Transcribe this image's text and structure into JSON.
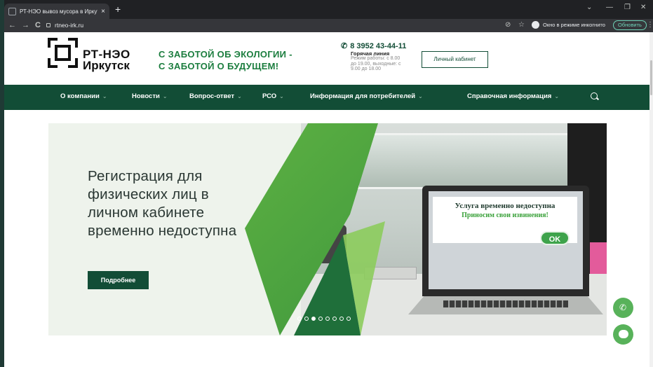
{
  "browser": {
    "tab_title": "РТ-НЭО вывоз мусора в Иркутс",
    "tab_close": "×",
    "new_tab": "+",
    "url": "rtneo-irk.ru",
    "incognito_label": "Окно в режиме инкогнито",
    "update_label": "Обновить",
    "nav": {
      "back": "←",
      "forward": "→",
      "reload": "C"
    },
    "window_controls": {
      "chevron": "⌄",
      "min": "—",
      "max": "❐",
      "close": "✕"
    },
    "icons": {
      "eye_off": "⊘",
      "star": "☆",
      "menu": "⋮"
    }
  },
  "site": {
    "logo_line1": "РТ-НЭО",
    "logo_line2": "Иркутск",
    "slogan_line1": "С ЗАБОТОЙ ОБ ЭКОЛОГИИ -",
    "slogan_line2": "С ЗАБОТОЙ О БУДУЩЕМ!",
    "phone_icon": "✆",
    "phone": "8 3952 43-44-11",
    "hotline": "Горячая линия",
    "hours": "Режим работы: с 8.00 до 19.00, выходные: с 9.00 до 18.00",
    "cabinet_button": "Личный кабинет"
  },
  "menu": {
    "items": [
      {
        "label": "О компании"
      },
      {
        "label": "Новости"
      },
      {
        "label": "Вопрос-ответ"
      },
      {
        "label": "РСО"
      },
      {
        "label": "Информация для потребителей"
      },
      {
        "label": "Справочная информация"
      }
    ],
    "chevron": "⌄"
  },
  "banner": {
    "title": "Регистрация для физических лиц в личном кабинете временно недоступна",
    "more_button": "Подробнее",
    "screen_message1": "Услуга временно недоступна",
    "screen_message2": "Приносим свои извинения!",
    "ok_button": "OK",
    "slides_total": 8,
    "active_slide": 3
  },
  "fab": {
    "phone_icon": "✆"
  },
  "colors": {
    "brand_green": "#124d36",
    "accent_green": "#1b7d3e",
    "fab_green": "#58b25a"
  }
}
